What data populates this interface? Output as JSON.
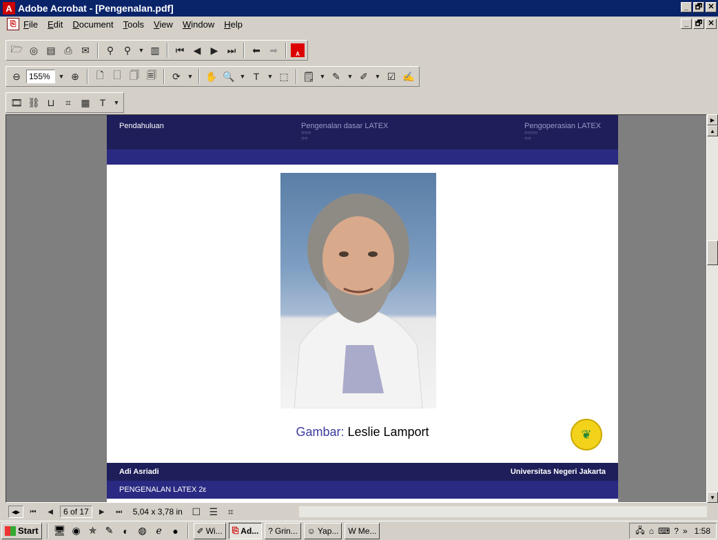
{
  "window": {
    "title": "Adobe Acrobat - [Pengenalan.pdf]",
    "minimize": "_",
    "restore": "🗗",
    "close": "✕"
  },
  "menu": [
    "File",
    "Edit",
    "Document",
    "Tools",
    "View",
    "Window",
    "Help"
  ],
  "toolbar": {
    "zoom_value": "155%"
  },
  "slide": {
    "nav_left": "Pendahuluan",
    "nav_mid": "Pengenalan dasar LATEX",
    "nav_mid_dots": "○○○",
    "nav_mid_dots2": "○○",
    "nav_right": "Pengoperasian LATEX",
    "nav_right_dots": "○○○○",
    "nav_right_dots2": "○○",
    "caption_label": "Gambar:",
    "caption_text": "Leslie Lamport",
    "footer_author": "Adi Asriadi",
    "footer_institution": "Universitas Negeri Jakarta",
    "footer_title": "PENGENALAN LATEX 2ε"
  },
  "status": {
    "page_indicator": "6 of 17",
    "page_size": "5,04 x 3,78 in"
  },
  "taskbar": {
    "start": "Start",
    "tasks": [
      "Wi...",
      "Ad...",
      "Grin...",
      "Yap...",
      "Me..."
    ],
    "clock": "1:58"
  }
}
